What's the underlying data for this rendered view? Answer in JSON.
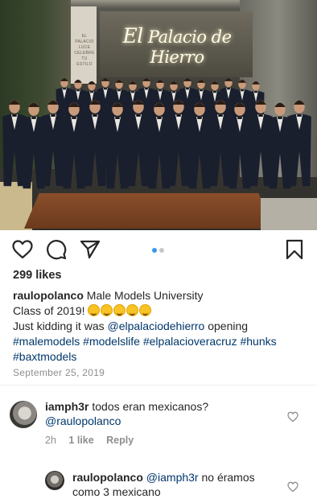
{
  "photo": {
    "store_panel_text": "EL PALACIO\nLUCE\nCELEBRE\nTU\nESTILO",
    "brand_sign_first": "El",
    "brand_sign_rest": "Palacio de Hierro"
  },
  "actions": {
    "like_icon": "heart-outline-icon",
    "comment_icon": "comment-bubble-icon",
    "share_icon": "paper-plane-icon",
    "save_icon": "bookmark-icon",
    "carousel_active_color": "#3897f0",
    "carousel_inactive_color": "#c7c7c7"
  },
  "post": {
    "likes": "299 likes",
    "username": "raulopolanco",
    "caption_line1": "Male Models University",
    "caption_line2": "Class of 2019!",
    "caption_line3_prefix": "Just kidding it was ",
    "mention": "@elpalaciodehierro",
    "caption_line3_suffix": " opening",
    "hashtags_line1": "#malemodels #modelslife #elpalacioveracruz #hunks",
    "hashtags_line2": "#baxtmodels",
    "date": "September 25, 2019",
    "link_color": "#00376b"
  },
  "comments": [
    {
      "username": "iamph3r",
      "text": "todos eran mexicanos?",
      "mention": "@raulopolanco",
      "time": "2h",
      "likes": "1 like",
      "reply": "Reply"
    },
    {
      "username": "raulopolanco",
      "mention": "@iamph3r",
      "text": "no éramos como 3 mexicano"
    }
  ]
}
